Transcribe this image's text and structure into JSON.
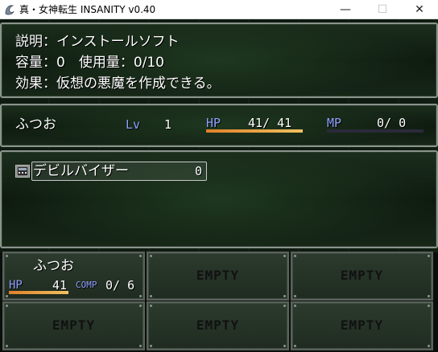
{
  "window": {
    "title": "真・女神転生 INSANITY v0.40",
    "minimize_glyph": "—",
    "maximize_glyph": "☐",
    "close_glyph": "✕"
  },
  "help": {
    "line1": "説明：インストールソフト",
    "line2": "容量：0　使用量：0/10",
    "line3": "効果：仮想の悪魔を作成できる。"
  },
  "status": {
    "name": "ふつお",
    "lv_label": "Lv",
    "lv_value": "1",
    "hp_label": "HP",
    "hp_value": "41/ 41",
    "hp_ratio": 1.0,
    "mp_label": "MP",
    "mp_value": "0/ 0",
    "mp_ratio": 0.0
  },
  "items": [
    {
      "icon": "comp-icon",
      "name": "デビルバイザー",
      "count": "0"
    }
  ],
  "party": [
    {
      "name": "ふつお",
      "hp_label": "HP",
      "hp_value": "41",
      "hp_ratio": 1.0,
      "comp_label": "COMP",
      "comp_value": "0/ 6"
    },
    {
      "empty_label": "EMPTY"
    },
    {
      "empty_label": "EMPTY"
    },
    {
      "empty_label": "EMPTY"
    },
    {
      "empty_label": "EMPTY"
    },
    {
      "empty_label": "EMPTY"
    }
  ],
  "colors": {
    "hp_bar": "#e0802a",
    "mp_bar": "#4050c0",
    "label_blue": "#8fa0ff"
  }
}
